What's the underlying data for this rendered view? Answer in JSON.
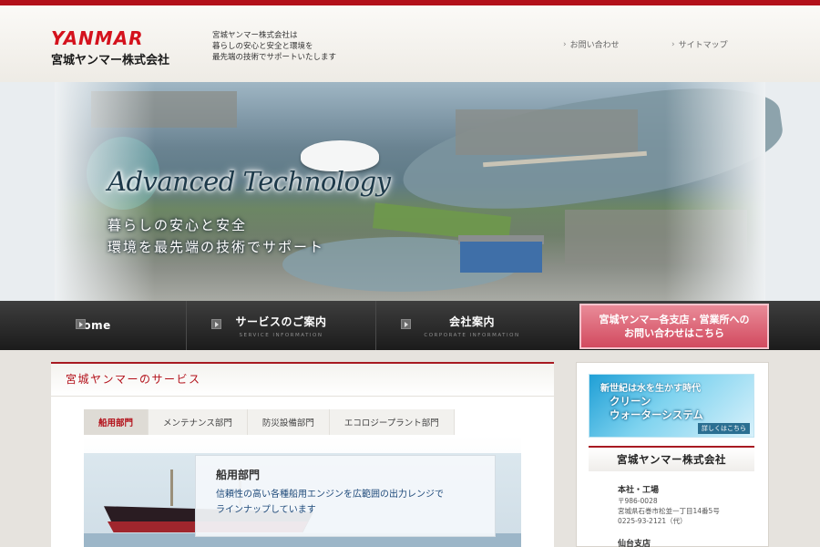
{
  "header": {
    "logo_brand": "YANMAR",
    "logo_company": "宮城ヤンマー株式会社",
    "tagline_lines": [
      "宮城ヤンマー株式会社は",
      "暮らしの安心と安全と環境を",
      "最先端の技術でサポートいたします"
    ],
    "nav": {
      "contact": "お問い合わせ",
      "sitemap": "サイトマップ"
    }
  },
  "hero": {
    "title": "Advanced Technology",
    "line1": "暮らしの安心と安全",
    "line2": "環境を最先端の技術でサポート"
  },
  "mainnav": {
    "home": "home",
    "service_label": "サービスのご案内",
    "service_sub": "SERVICE INFORMATION",
    "company_label": "会社案内",
    "company_sub": "CORPORATE INFORMATION",
    "cta_line1": "宮城ヤンマー各支店・営業所への",
    "cta_line2": "お問い合わせはこちら"
  },
  "services": {
    "title": "宮城ヤンマーのサービス",
    "tabs": [
      {
        "label": "船用部門",
        "active": true
      },
      {
        "label": "メンテナンス部門",
        "active": false
      },
      {
        "label": "防災設備部門",
        "active": false
      },
      {
        "label": "エコロジープラント部門",
        "active": false
      }
    ],
    "panel_title": "船用部門",
    "panel_body_lines": [
      "信頼性の高い各種船用エンジンを広範囲の出力レンジで",
      "ラインナップしています"
    ]
  },
  "sidebar": {
    "banner_top": "新世紀は水を生かす時代",
    "banner_main_lines": [
      "クリーン",
      "ウォーターシステム"
    ],
    "banner_link": "詳しくはこちら",
    "company_title": "宮城ヤンマー株式会社",
    "office_label": "本社・工場",
    "address_lines": [
      "〒986-0028",
      "宮城県石巻市松並一丁目14番5号",
      "0225-93-2121（代）"
    ],
    "next_office": "仙台支店"
  },
  "colors": {
    "brand_red": "#b3111a",
    "cta_pink": "#d24a5f",
    "nav_dark": "#1b1b1b"
  }
}
